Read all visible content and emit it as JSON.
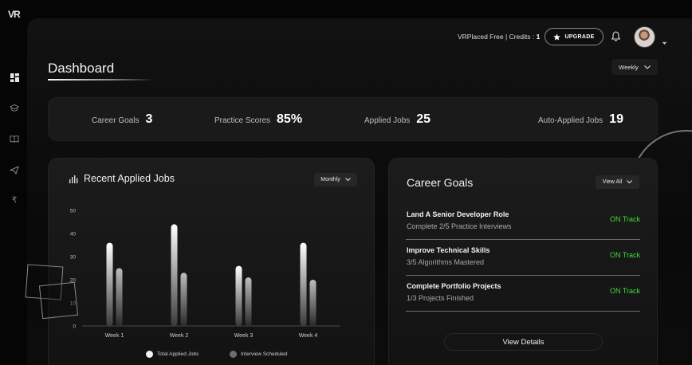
{
  "app": {
    "logo": "VR"
  },
  "sidebar": {
    "items": [
      {
        "name": "dashboard",
        "icon": "grid-icon"
      },
      {
        "name": "career",
        "icon": "graduation-cap-icon"
      },
      {
        "name": "practice",
        "icon": "book-icon"
      },
      {
        "name": "jobs",
        "icon": "send-icon"
      },
      {
        "name": "pricing",
        "icon": "rupee-icon",
        "glyph": "₹"
      }
    ]
  },
  "topbar": {
    "plan_text": "VRPlaced Free | Credits : ",
    "credits": "1",
    "upgrade_label": "UPGRADE"
  },
  "page": {
    "title": "Dashboard",
    "period": "Weekly"
  },
  "stats": [
    {
      "label": "Career Goals",
      "value": "3"
    },
    {
      "label": "Practice Scores",
      "value": "85%"
    },
    {
      "label": "Applied Jobs",
      "value": "25"
    },
    {
      "label": "Auto-Applied Jobs",
      "value": "19"
    }
  ],
  "recent_jobs": {
    "title": "Recent Applied Jobs",
    "filter": "Monthly"
  },
  "chart_data": {
    "type": "bar",
    "categories": [
      "Week 1",
      "Week 2",
      "Week 3",
      "Week 4"
    ],
    "series": [
      {
        "name": "Total Applied Jobs",
        "values": [
          36,
          44,
          26,
          36
        ],
        "color": "#f2f2f2"
      },
      {
        "name": "Interview Scheduled",
        "values": [
          25,
          23,
          21,
          20
        ],
        "color": "#8a8a8a"
      }
    ],
    "yticks": [
      "0",
      "10",
      "20",
      "30",
      "40",
      "50"
    ],
    "ylim": [
      0,
      50
    ],
    "legend_position": "bottom"
  },
  "career_goals": {
    "title": "Career Goals",
    "filter": "View All",
    "items": [
      {
        "title": "Land A Senior Developer Role",
        "subtitle": "Complete 2/5 Practice Interviews",
        "status": "ON Track"
      },
      {
        "title": "Improve Technical Skills",
        "subtitle": "3/5 Algorithms Mastered",
        "status": "ON Track"
      },
      {
        "title": "Complete Portfolio Projects",
        "subtitle": "1/3 Projects Finished",
        "status": "ON Track"
      }
    ],
    "details_label": "View Details"
  }
}
